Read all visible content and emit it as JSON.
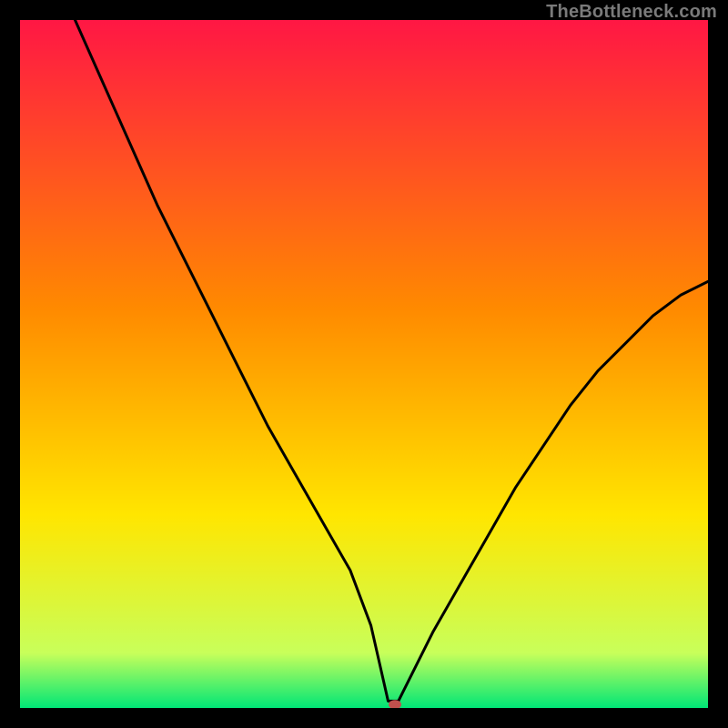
{
  "watermark": "TheBottleneck.com",
  "chart_data": {
    "type": "line",
    "title": "",
    "xlabel": "",
    "ylabel": "",
    "xlim": [
      0,
      100
    ],
    "ylim": [
      0,
      100
    ],
    "axes_visible": false,
    "grid": false,
    "legend": false,
    "background_gradient": [
      "#ff1744",
      "#ff8a00",
      "#ffe600",
      "#c8ff5a",
      "#00e676"
    ],
    "marker": {
      "x": 54.5,
      "y": 0.5,
      "color": "#c0504d"
    },
    "series": [
      {
        "name": "curve",
        "color": "#000000",
        "x": [
          8,
          12,
          16,
          20,
          24,
          28,
          32,
          36,
          40,
          44,
          48,
          51,
          53.5,
          55,
          57,
          60,
          64,
          68,
          72,
          76,
          80,
          84,
          88,
          92,
          96,
          100
        ],
        "y": [
          100,
          91,
          82,
          73,
          65,
          57,
          49,
          41,
          34,
          27,
          20,
          12,
          1,
          1,
          5,
          11,
          18,
          25,
          32,
          38,
          44,
          49,
          53,
          57,
          60,
          62
        ]
      }
    ]
  }
}
